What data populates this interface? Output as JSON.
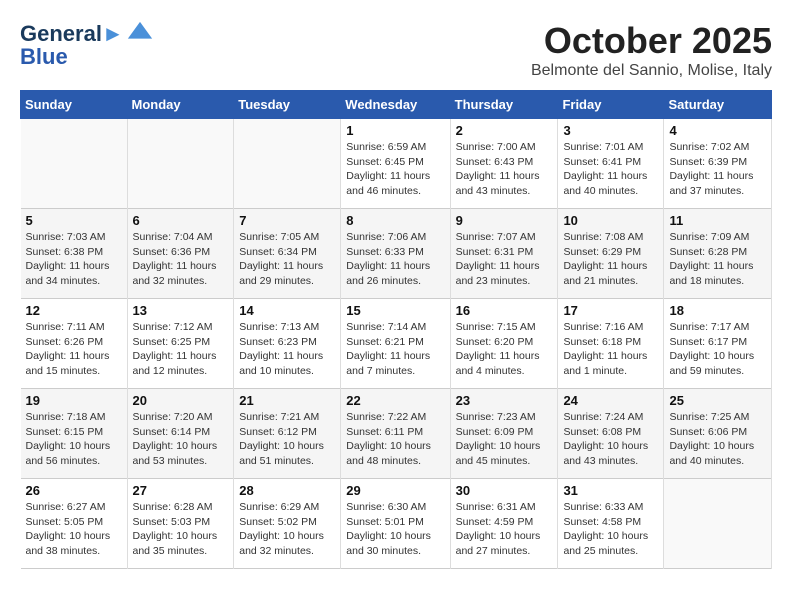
{
  "header": {
    "logo_line1": "General",
    "logo_line2": "Blue",
    "month": "October 2025",
    "location": "Belmonte del Sannio, Molise, Italy"
  },
  "weekdays": [
    "Sunday",
    "Monday",
    "Tuesday",
    "Wednesday",
    "Thursday",
    "Friday",
    "Saturday"
  ],
  "weeks": [
    [
      {
        "day": "",
        "info": ""
      },
      {
        "day": "",
        "info": ""
      },
      {
        "day": "",
        "info": ""
      },
      {
        "day": "1",
        "info": "Sunrise: 6:59 AM\nSunset: 6:45 PM\nDaylight: 11 hours\nand 46 minutes."
      },
      {
        "day": "2",
        "info": "Sunrise: 7:00 AM\nSunset: 6:43 PM\nDaylight: 11 hours\nand 43 minutes."
      },
      {
        "day": "3",
        "info": "Sunrise: 7:01 AM\nSunset: 6:41 PM\nDaylight: 11 hours\nand 40 minutes."
      },
      {
        "day": "4",
        "info": "Sunrise: 7:02 AM\nSunset: 6:39 PM\nDaylight: 11 hours\nand 37 minutes."
      }
    ],
    [
      {
        "day": "5",
        "info": "Sunrise: 7:03 AM\nSunset: 6:38 PM\nDaylight: 11 hours\nand 34 minutes."
      },
      {
        "day": "6",
        "info": "Sunrise: 7:04 AM\nSunset: 6:36 PM\nDaylight: 11 hours\nand 32 minutes."
      },
      {
        "day": "7",
        "info": "Sunrise: 7:05 AM\nSunset: 6:34 PM\nDaylight: 11 hours\nand 29 minutes."
      },
      {
        "day": "8",
        "info": "Sunrise: 7:06 AM\nSunset: 6:33 PM\nDaylight: 11 hours\nand 26 minutes."
      },
      {
        "day": "9",
        "info": "Sunrise: 7:07 AM\nSunset: 6:31 PM\nDaylight: 11 hours\nand 23 minutes."
      },
      {
        "day": "10",
        "info": "Sunrise: 7:08 AM\nSunset: 6:29 PM\nDaylight: 11 hours\nand 21 minutes."
      },
      {
        "day": "11",
        "info": "Sunrise: 7:09 AM\nSunset: 6:28 PM\nDaylight: 11 hours\nand 18 minutes."
      }
    ],
    [
      {
        "day": "12",
        "info": "Sunrise: 7:11 AM\nSunset: 6:26 PM\nDaylight: 11 hours\nand 15 minutes."
      },
      {
        "day": "13",
        "info": "Sunrise: 7:12 AM\nSunset: 6:25 PM\nDaylight: 11 hours\nand 12 minutes."
      },
      {
        "day": "14",
        "info": "Sunrise: 7:13 AM\nSunset: 6:23 PM\nDaylight: 11 hours\nand 10 minutes."
      },
      {
        "day": "15",
        "info": "Sunrise: 7:14 AM\nSunset: 6:21 PM\nDaylight: 11 hours\nand 7 minutes."
      },
      {
        "day": "16",
        "info": "Sunrise: 7:15 AM\nSunset: 6:20 PM\nDaylight: 11 hours\nand 4 minutes."
      },
      {
        "day": "17",
        "info": "Sunrise: 7:16 AM\nSunset: 6:18 PM\nDaylight: 11 hours\nand 1 minute."
      },
      {
        "day": "18",
        "info": "Sunrise: 7:17 AM\nSunset: 6:17 PM\nDaylight: 10 hours\nand 59 minutes."
      }
    ],
    [
      {
        "day": "19",
        "info": "Sunrise: 7:18 AM\nSunset: 6:15 PM\nDaylight: 10 hours\nand 56 minutes."
      },
      {
        "day": "20",
        "info": "Sunrise: 7:20 AM\nSunset: 6:14 PM\nDaylight: 10 hours\nand 53 minutes."
      },
      {
        "day": "21",
        "info": "Sunrise: 7:21 AM\nSunset: 6:12 PM\nDaylight: 10 hours\nand 51 minutes."
      },
      {
        "day": "22",
        "info": "Sunrise: 7:22 AM\nSunset: 6:11 PM\nDaylight: 10 hours\nand 48 minutes."
      },
      {
        "day": "23",
        "info": "Sunrise: 7:23 AM\nSunset: 6:09 PM\nDaylight: 10 hours\nand 45 minutes."
      },
      {
        "day": "24",
        "info": "Sunrise: 7:24 AM\nSunset: 6:08 PM\nDaylight: 10 hours\nand 43 minutes."
      },
      {
        "day": "25",
        "info": "Sunrise: 7:25 AM\nSunset: 6:06 PM\nDaylight: 10 hours\nand 40 minutes."
      }
    ],
    [
      {
        "day": "26",
        "info": "Sunrise: 6:27 AM\nSunset: 5:05 PM\nDaylight: 10 hours\nand 38 minutes."
      },
      {
        "day": "27",
        "info": "Sunrise: 6:28 AM\nSunset: 5:03 PM\nDaylight: 10 hours\nand 35 minutes."
      },
      {
        "day": "28",
        "info": "Sunrise: 6:29 AM\nSunset: 5:02 PM\nDaylight: 10 hours\nand 32 minutes."
      },
      {
        "day": "29",
        "info": "Sunrise: 6:30 AM\nSunset: 5:01 PM\nDaylight: 10 hours\nand 30 minutes."
      },
      {
        "day": "30",
        "info": "Sunrise: 6:31 AM\nSunset: 4:59 PM\nDaylight: 10 hours\nand 27 minutes."
      },
      {
        "day": "31",
        "info": "Sunrise: 6:33 AM\nSunset: 4:58 PM\nDaylight: 10 hours\nand 25 minutes."
      },
      {
        "day": "",
        "info": ""
      }
    ]
  ]
}
